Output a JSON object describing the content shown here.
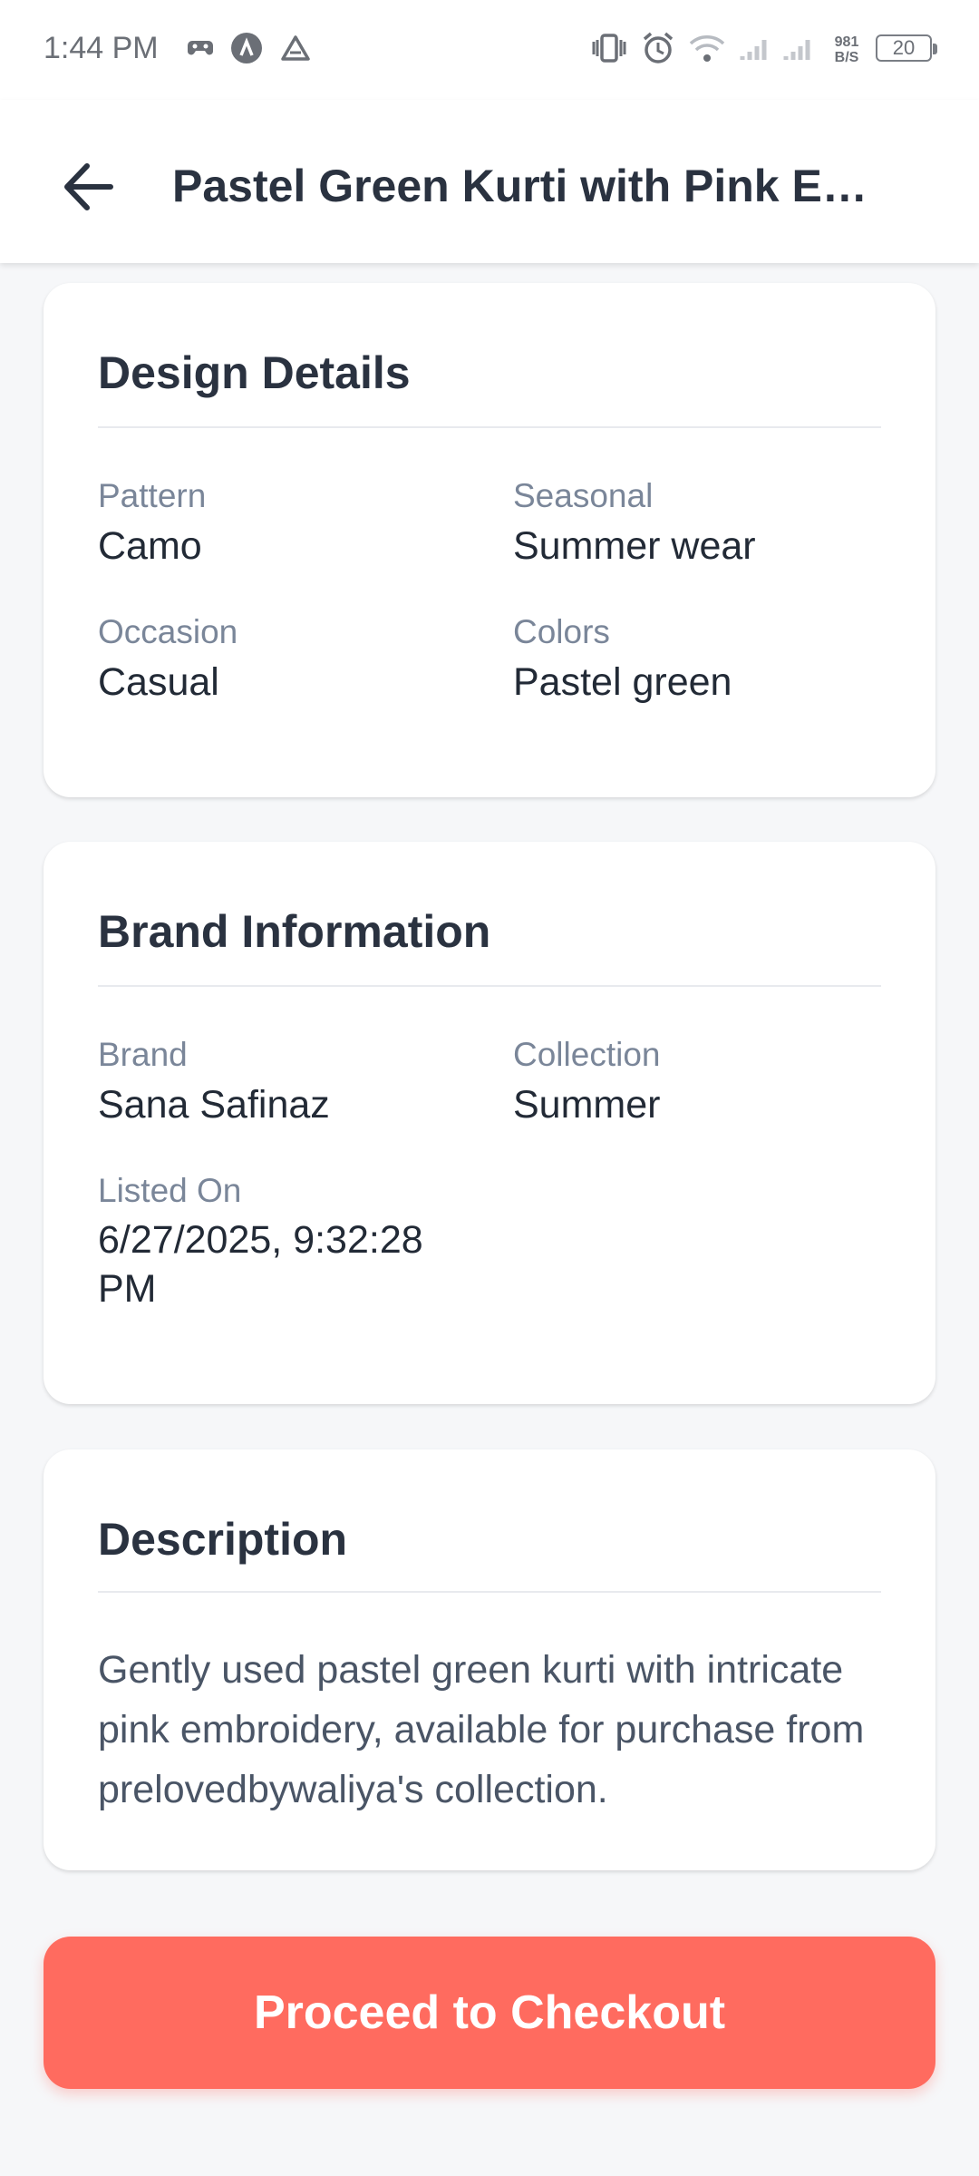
{
  "status_bar": {
    "time": "1:44 PM",
    "net_speed_value": "981",
    "net_speed_unit": "B/S",
    "battery": "20",
    "icons": [
      "game-controller-icon",
      "a-circle-icon",
      "drive-icon",
      "vibrate-icon",
      "alarm-icon",
      "wifi-icon",
      "signal-icon",
      "signal-icon"
    ]
  },
  "app_bar": {
    "title": "Pastel Green Kurti with Pink Embroidery",
    "back_icon": "arrow-left-icon"
  },
  "design_details": {
    "title": "Design Details",
    "pattern_label": "Pattern",
    "pattern_value": "Camo",
    "seasonal_label": "Seasonal",
    "seasonal_value": "Summer wear",
    "occasion_label": "Occasion",
    "occasion_value": "Casual",
    "colors_label": "Colors",
    "colors_value": "Pastel green"
  },
  "brand_information": {
    "title": "Brand Information",
    "brand_label": "Brand",
    "brand_value": "Sana Safinaz",
    "collection_label": "Collection",
    "collection_value": "Summer",
    "listed_label": "Listed On",
    "listed_value": "6/27/2025, 9:32:28 PM"
  },
  "description": {
    "title": "Description",
    "text": "Gently used pastel green kurti with intricate pink embroidery, available for purchase from prelovedbywaliya's collection."
  },
  "checkout": {
    "label": "Proceed to Checkout"
  },
  "colors": {
    "accent": "#ff6b5f",
    "text_primary": "#2a3240",
    "label": "#7a8699",
    "background": "#f6f7f9"
  }
}
